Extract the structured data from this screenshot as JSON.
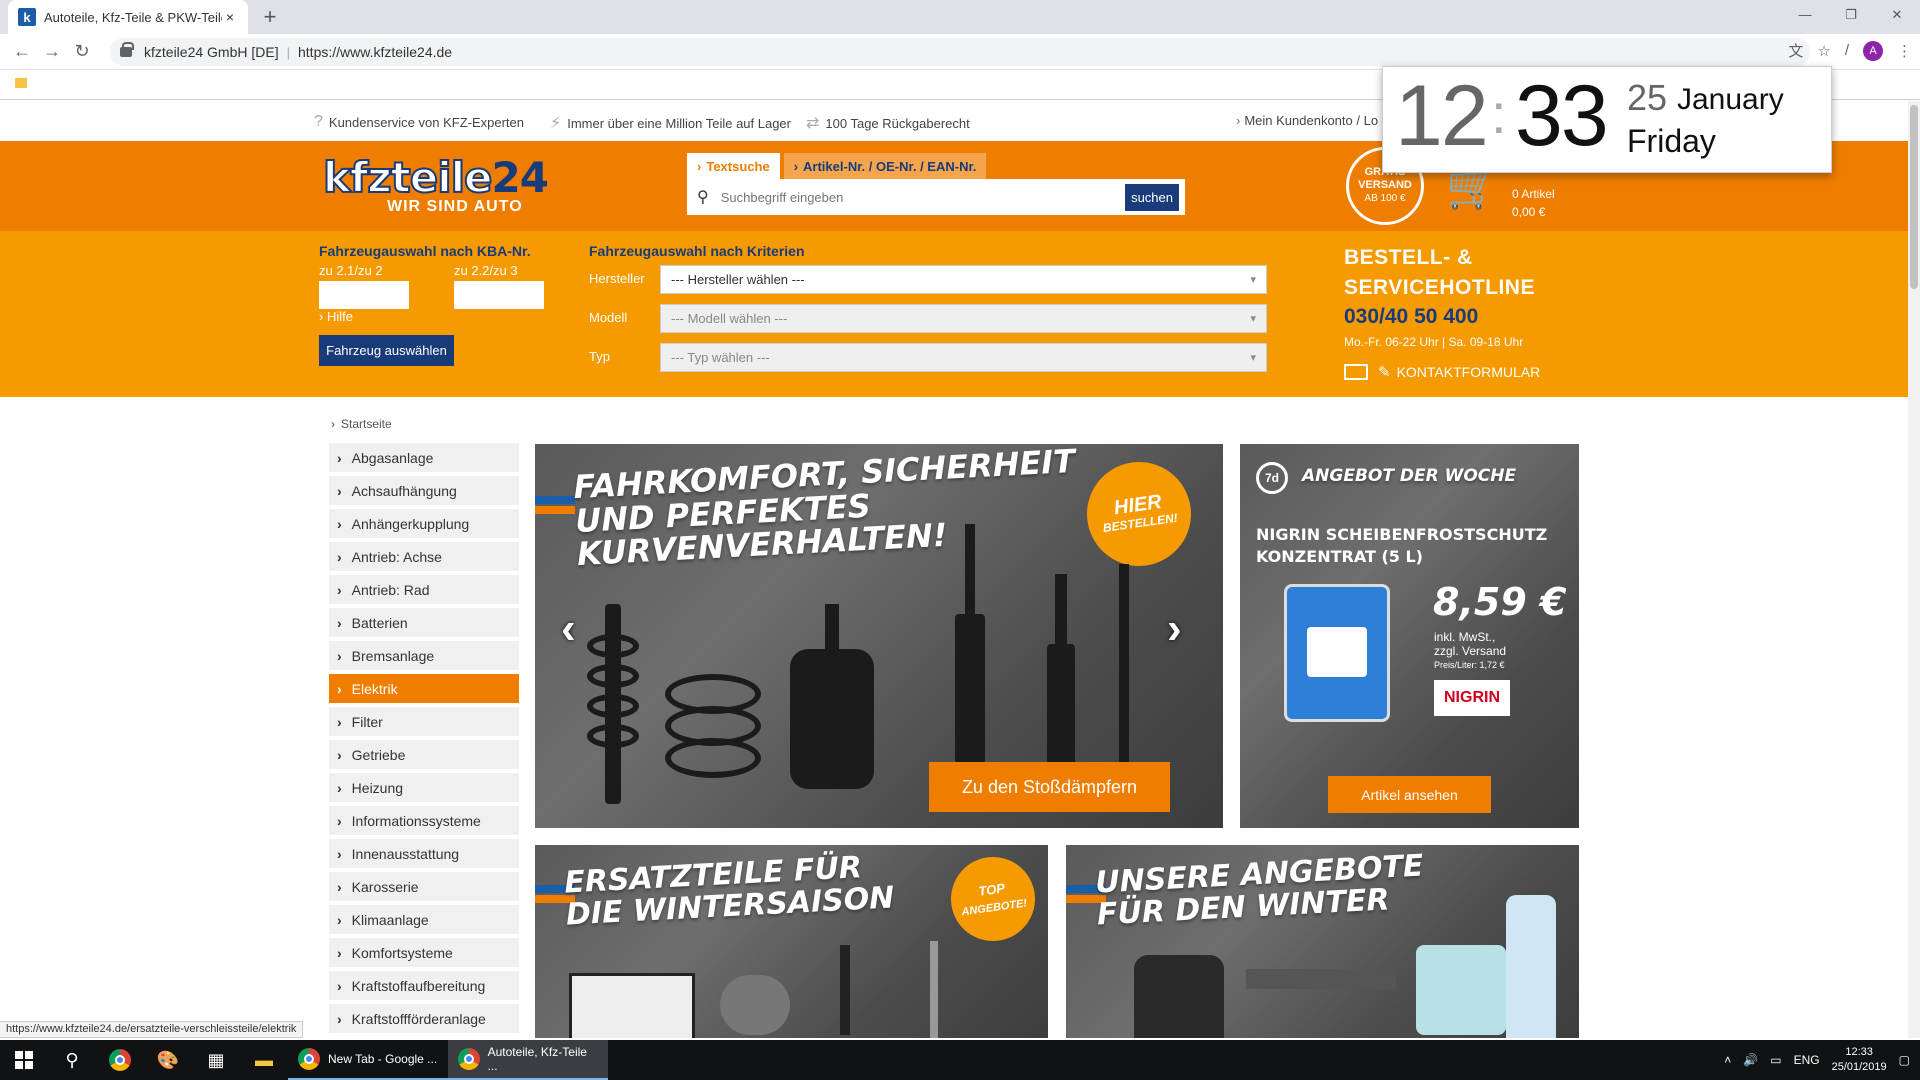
{
  "browser": {
    "tab_title": "Autoteile, Kfz-Teile & PKW-Teile",
    "tab_close": "×",
    "new_tab": "+",
    "site_identity": "kfzteile24 GmbH [DE]",
    "url": "https://www.kfzteile24.de",
    "profile_initial": "A",
    "status_url": "https://www.kfzteile24.de/ersatzteile-verschleissteile/elektrik"
  },
  "usp": {
    "service": "Kundenservice von KFZ-Experten",
    "parts": "Immer über eine Million Teile auf Lager",
    "returns": "100 Tage Rückgaberecht",
    "account": "Mein Kundenkonto / Lo"
  },
  "logo": {
    "main_a": "kfzteile",
    "main_b": "24",
    "sub": "WIR SIND AUTO"
  },
  "search": {
    "tab_text": "Textsuche",
    "tab_article": "Artikel-Nr. / OE-Nr. / EAN-Nr.",
    "placeholder": "Suchbegriff eingeben",
    "button": "suchen"
  },
  "gratis": {
    "l1": "GRATIS",
    "l2": "VERSAND",
    "l3": "AB 100 €"
  },
  "cart": {
    "items": "0 Artikel",
    "total": "0,00 €"
  },
  "kba": {
    "title": "Fahrzeugauswahl nach KBA-Nr.",
    "label1": "zu 2.1/zu 2",
    "label2": "zu 2.2/zu 3",
    "help": "Hilfe",
    "button": "Fahrzeug auswählen"
  },
  "criteria": {
    "title": "Fahrzeugauswahl nach Kriterien",
    "maker_label": "Hersteller",
    "maker_value": "--- Hersteller wählen ---",
    "model_label": "Modell",
    "model_value": "--- Modell wählen ---",
    "type_label": "Typ",
    "type_value": "--- Typ wählen ---"
  },
  "hotline": {
    "title_1": "BESTELL- &",
    "title_2": "SERVICEHOTLINE",
    "number": "030/40 50 400",
    "hours": "Mo.-Fr. 06-22 Uhr | Sa. 09-18 Uhr",
    "contact": "KONTAKTFORMULAR"
  },
  "breadcrumb": "Startseite",
  "categories": [
    "Abgasanlage",
    "Achsaufhängung",
    "Anhängerkupplung",
    "Antrieb: Achse",
    "Antrieb: Rad",
    "Batterien",
    "Bremsanlage",
    "Elektrik",
    "Filter",
    "Getriebe",
    "Heizung",
    "Informationssysteme",
    "Innenausstattung",
    "Karosserie",
    "Klimaanlage",
    "Komfortsysteme",
    "Kraftstoffaufbereitung",
    "Kraftstoffförderanlage"
  ],
  "banner_main": {
    "headline_1": "FAHRKOMFORT, SICHERHEIT",
    "headline_2": "UND PERFEKTES",
    "headline_3": "KURVENVERHALTEN!",
    "badge_1": "HIER",
    "badge_2": "BESTELLEN!",
    "cta": "Zu den Stoßdämpfern"
  },
  "banner_side": {
    "badge": "7d",
    "title": "ANGEBOT DER WOCHE",
    "product_1": "NIGRIN SCHEIBENFROSTSCHUTZ",
    "product_2": "KONZENTRAT (5 L)",
    "price": "8,59 €",
    "tax_1": "inkl. MwSt.,",
    "tax_2": "zzgl. Versand",
    "unit_price": "Preis/Liter: 1,72 €",
    "brand": "NIGRIN",
    "cta": "Artikel ansehen"
  },
  "banner_bl": {
    "headline_1": "ERSATZTEILE FÜR",
    "headline_2": "DIE WINTERSAISON",
    "badge_1": "TOP",
    "badge_2": "ANGEBOTE!"
  },
  "banner_br": {
    "headline_1": "UNSERE ANGEBOTE",
    "headline_2": "FÜR DEN WINTER"
  },
  "clock": {
    "hour": "12",
    "minute": "33",
    "day": "25",
    "month": "January",
    "weekday": "Friday"
  },
  "taskbar": {
    "app_1": "New Tab - Google ...",
    "app_2": "Autoteile, Kfz-Teile ...",
    "lang": "ENG",
    "time": "12:33",
    "date": "25/01/2019"
  },
  "colors": {
    "brand_orange": "#ef7d00",
    "light_orange": "#f59a00",
    "navy": "#1a3b7a"
  }
}
